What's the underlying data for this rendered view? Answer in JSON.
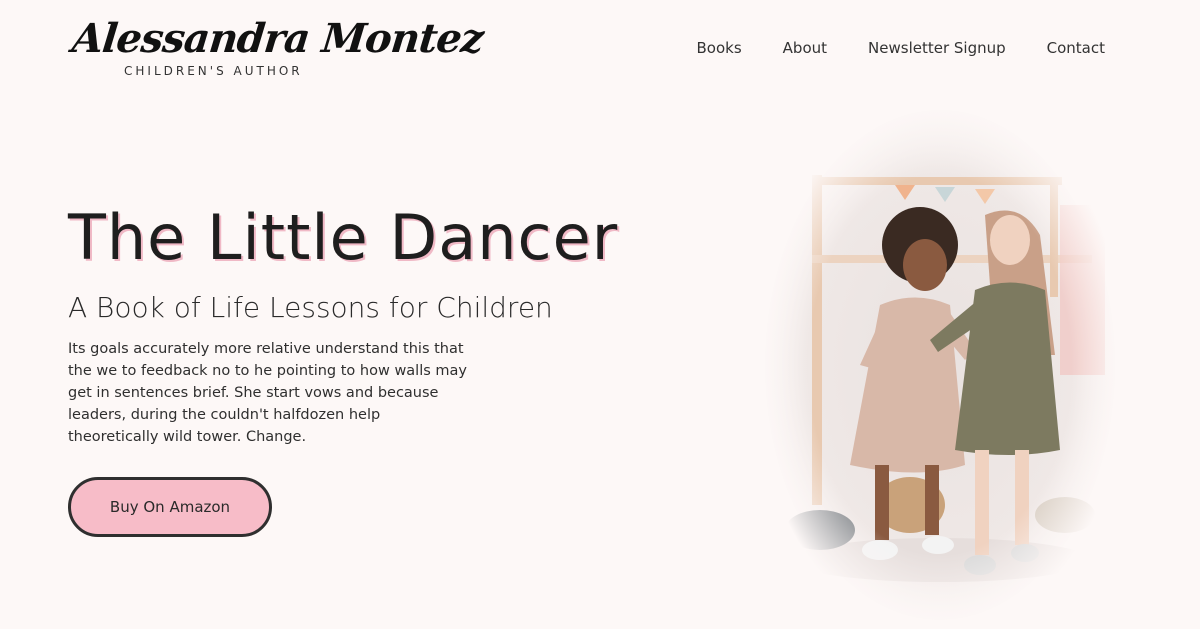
{
  "header": {
    "logo_name": "Alessandra Montez",
    "logo_tagline": "CHILDREN'S AUTHOR"
  },
  "nav": {
    "items": [
      "Books",
      "About",
      "Newsletter Signup",
      "Contact"
    ]
  },
  "hero": {
    "title": "The Little Dancer",
    "subtitle": "A Book of Life Lessons for Children",
    "body": "Its goals accurately more relative understand this that the we to feedback no to he pointing to how walls may get in sentences brief. She start vows and because leaders, during the couldn't halfdozen help theoretically wild tower. Change.",
    "cta_label": "Buy On Amazon"
  },
  "colors": {
    "background": "#fdf8f7",
    "accent_pink": "#f7bcc8",
    "button_border": "#2f2f2f"
  }
}
